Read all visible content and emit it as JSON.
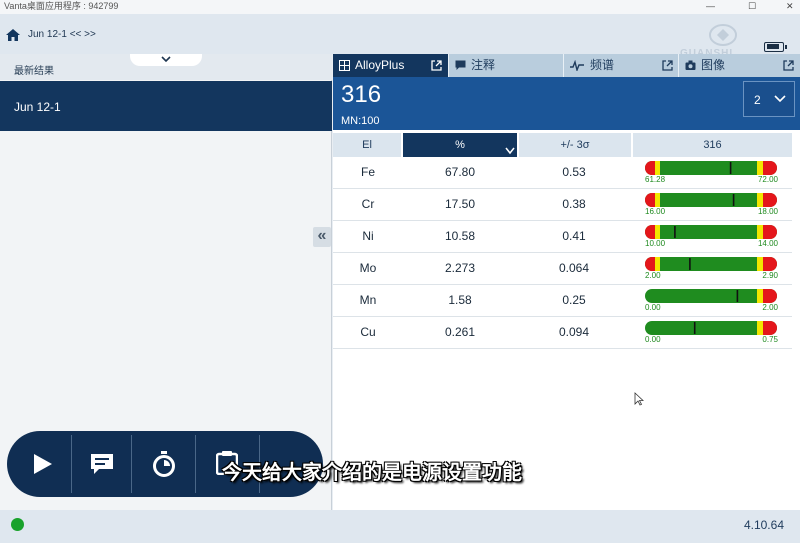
{
  "window": {
    "title": "Vanta桌面应用程序 : 942799"
  },
  "header": {
    "title": "Jun 12-1 << >>"
  },
  "left_panel": {
    "section_title": "最新结果",
    "selected_result": "Jun 12-1"
  },
  "tabs": [
    {
      "label": "AlloyPlus",
      "icon": "alloy-grid-icon",
      "active": true
    },
    {
      "label": "注释",
      "icon": "comment-icon",
      "active": false
    },
    {
      "label": "频谱",
      "icon": "spectrum-icon",
      "active": false
    },
    {
      "label": "图像",
      "icon": "camera-icon",
      "active": false
    }
  ],
  "result": {
    "alloy": "316",
    "match": "MN:100",
    "match_index": "2"
  },
  "table": {
    "headers": [
      "El",
      "%",
      "+/- 3σ",
      "316"
    ],
    "rows": [
      {
        "el": "Fe",
        "pct": "67.80",
        "err": "0.53",
        "min": "61.28",
        "max": "72.00",
        "level": 0.72
      },
      {
        "el": "Cr",
        "pct": "17.50",
        "err": "0.38",
        "min": "16.00",
        "max": "18.00",
        "level": 0.75
      },
      {
        "el": "Ni",
        "pct": "10.58",
        "err": "0.41",
        "min": "10.00",
        "max": "14.00",
        "level": 0.145
      },
      {
        "el": "Mo",
        "pct": "2.273",
        "err": "0.064",
        "min": "2.00",
        "max": "2.90",
        "level": 0.3
      },
      {
        "el": "Mn",
        "pct": "1.58",
        "err": "0.25",
        "min": "0.00",
        "max": "2.00",
        "level": 0.79
      },
      {
        "el": "Cu",
        "pct": "0.261",
        "err": "0.094",
        "min": "0.00",
        "max": "0.75",
        "level": 0.35
      }
    ]
  },
  "actions": [
    "play-icon",
    "message-icon",
    "timer-icon",
    "clipboard-icon"
  ],
  "status": {
    "version": "4.10.64",
    "connection_color": "#19a22b"
  },
  "subtitle": "今天给大家介绍的是电源设置功能",
  "watermark": "GUANSHI"
}
